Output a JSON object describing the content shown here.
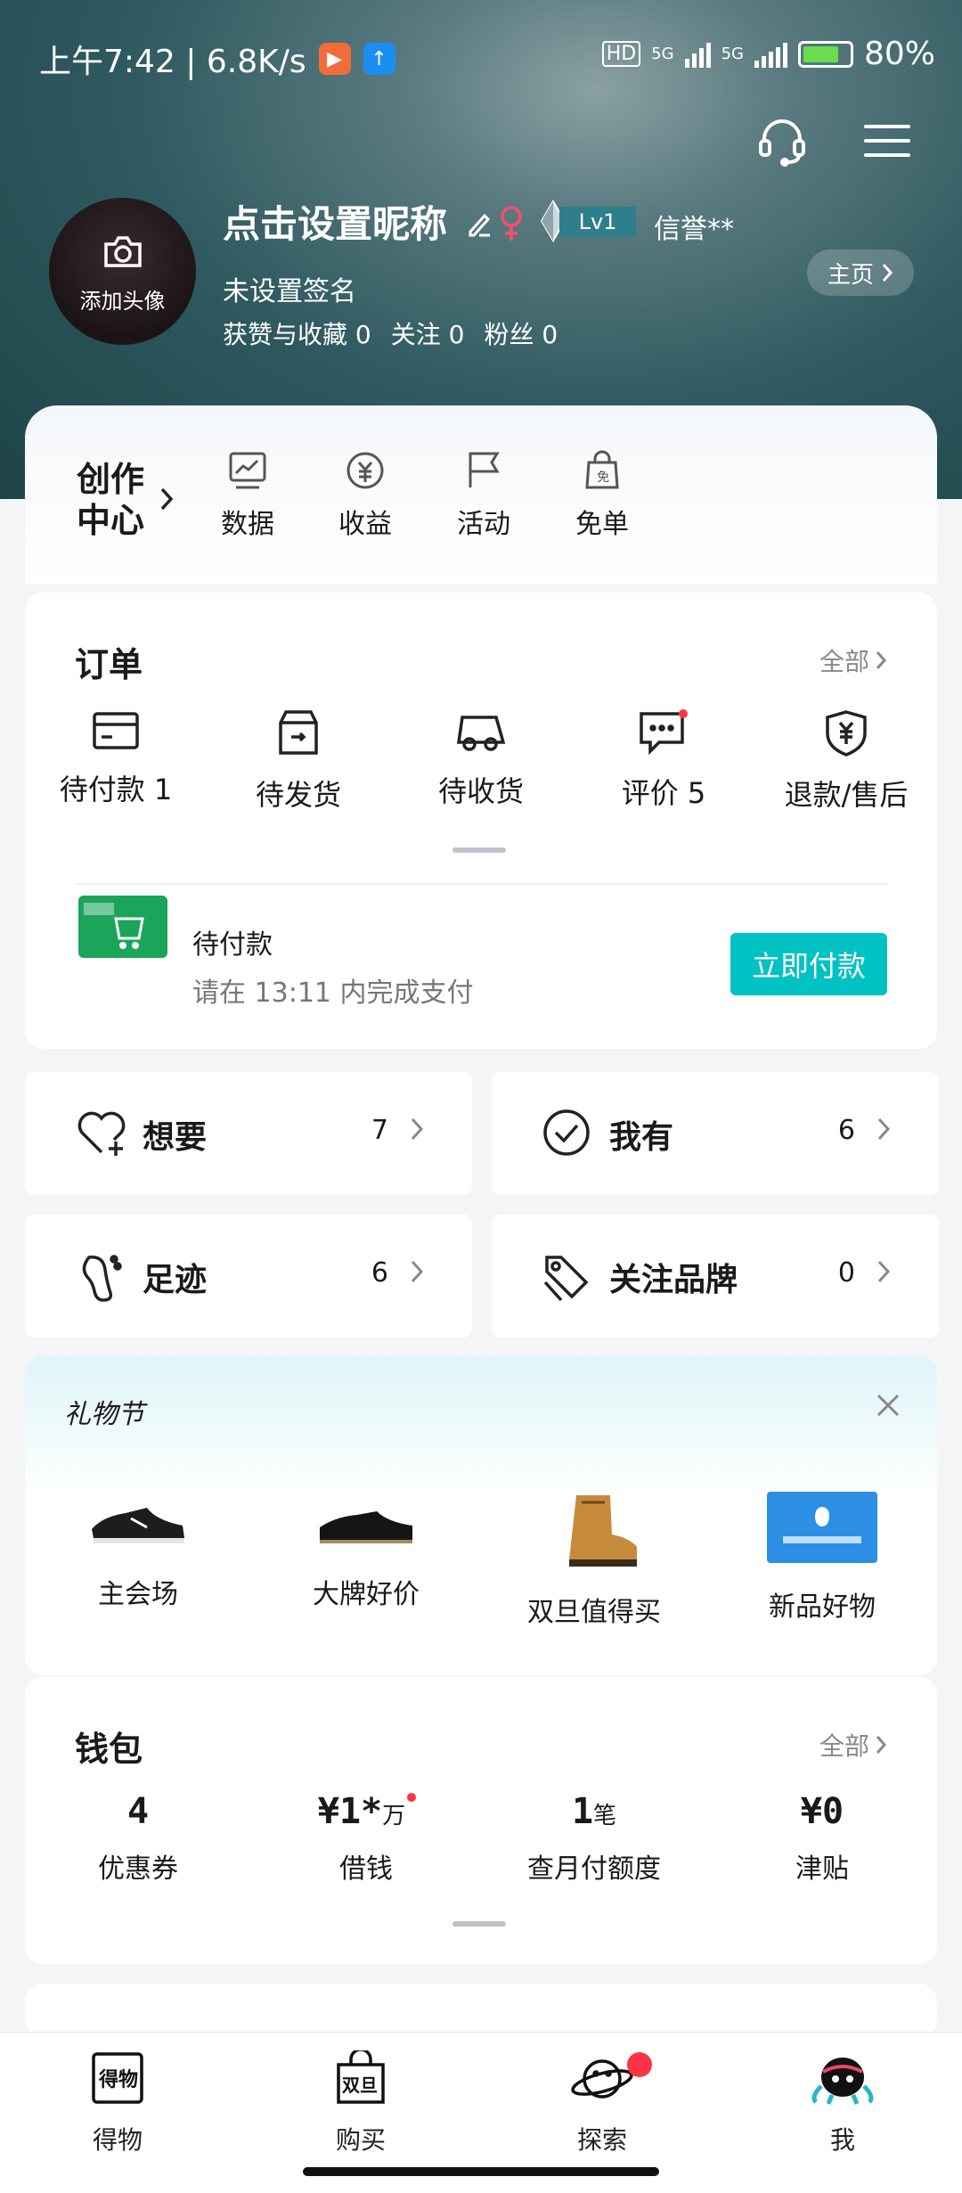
{
  "status_bar": {
    "time_speed": "上午7:42 | 6.8K/s",
    "network": "5G",
    "network2": "5G",
    "hd": "HD",
    "battery": "80%"
  },
  "profile": {
    "avatar_label": "添加头像",
    "nickname": "点击设置昵称",
    "level": "Lv1",
    "credit": "信誉**",
    "signature": "未设置签名",
    "stats": {
      "likes_label": "获赞与收藏",
      "likes": "0",
      "follow_label": "关注",
      "follow": "0",
      "fans_label": "粉丝",
      "fans": "0"
    },
    "home_button": "主页"
  },
  "creator": {
    "title": "创作中心",
    "items": [
      {
        "label": "数据",
        "icon": "chart-icon"
      },
      {
        "label": "收益",
        "icon": "yuan-circle-icon"
      },
      {
        "label": "活动",
        "icon": "flag-icon"
      },
      {
        "label": "免单",
        "icon": "bag-icon"
      }
    ]
  },
  "orders": {
    "title": "订单",
    "all": "全部",
    "items": [
      {
        "label": "待付款 1",
        "icon": "wallet-card-icon"
      },
      {
        "label": "待发货",
        "icon": "box-icon"
      },
      {
        "label": "待收货",
        "icon": "truck-icon"
      },
      {
        "label": "评价 5",
        "icon": "comment-icon"
      },
      {
        "label": "退款/售后",
        "icon": "shield-yuan-icon"
      }
    ],
    "pending": {
      "title": "待付款",
      "subtitle": "请在 13:11 内完成支付",
      "pay_button": "立即付款"
    }
  },
  "shortcuts": [
    {
      "label": "想要",
      "count": "7",
      "icon": "heart-plus-icon"
    },
    {
      "label": "我有",
      "count": "6",
      "icon": "check-circle-icon"
    },
    {
      "label": "足迹",
      "count": "6",
      "icon": "footprint-icon"
    },
    {
      "label": "关注品牌",
      "count": "0",
      "icon": "tag-icon"
    }
  ],
  "gift": {
    "logo": "礼物节",
    "items": [
      {
        "label": "主会场"
      },
      {
        "label": "大牌好价"
      },
      {
        "label": "双旦值得买"
      },
      {
        "label": "新品好物"
      }
    ]
  },
  "wallet": {
    "title": "钱包",
    "all": "全部",
    "items": [
      {
        "value": "4",
        "unit": "",
        "label": "优惠券"
      },
      {
        "value": "¥1*",
        "unit": "万",
        "label": "借钱"
      },
      {
        "value": "1",
        "unit": "笔",
        "label": "查月付额度"
      },
      {
        "value": "¥0",
        "unit": "",
        "label": "津贴"
      }
    ]
  },
  "tabbar": [
    {
      "label": "得物",
      "icon": "dewu-logo-icon"
    },
    {
      "label": "购买",
      "icon": "shopping-bag-icon"
    },
    {
      "label": "探索",
      "icon": "planet-icon"
    },
    {
      "label": "我",
      "icon": "mascot-icon"
    }
  ]
}
